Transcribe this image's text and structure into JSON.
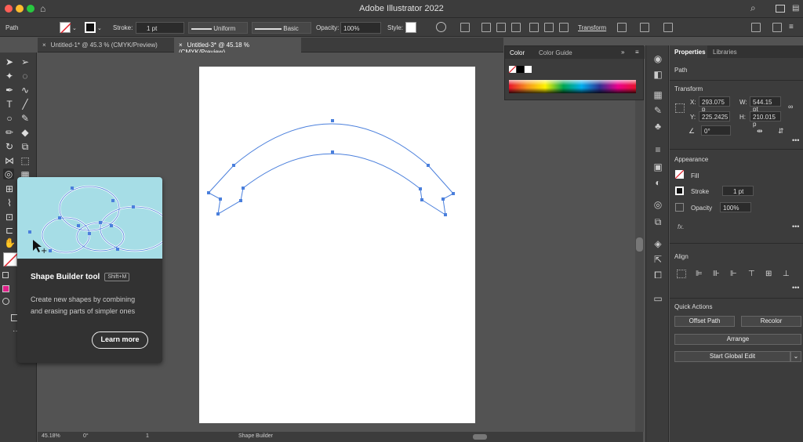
{
  "app": {
    "title": "Adobe Illustrator 2022"
  },
  "control": {
    "selection": "Path",
    "stroke_label": "Stroke:",
    "stroke_weight": "1 pt",
    "profile": "Uniform",
    "brush": "Basic",
    "opacity_label": "Opacity:",
    "opacity": "100%",
    "style_label": "Style:",
    "transform": "Transform"
  },
  "tabs": [
    {
      "label": "Untitled-1* @ 45.3 % (CMYK/Preview)"
    },
    {
      "label": "Untitled-3* @ 45.18 % (CMYK/Preview)"
    }
  ],
  "tooltip": {
    "title": "Shape Builder tool",
    "shortcut": "Shift+M",
    "description_line1": "Create new shapes by combining",
    "description_line2": "and erasing parts of simpler ones",
    "button": "Learn more"
  },
  "color_panel": {
    "tab1": "Color",
    "tab2": "Color Guide"
  },
  "properties": {
    "tab1": "Properties",
    "tab2": "Libraries",
    "object": "Path",
    "transform_title": "Transform",
    "x_label": "X:",
    "x": "293.075 p",
    "w_label": "W:",
    "w": "544.15 pt",
    "y_label": "Y:",
    "y": "225.2425",
    "h_label": "H:",
    "h": "210.015 p",
    "angle": "0°",
    "appearance_title": "Appearance",
    "fill": "Fill",
    "stroke": "Stroke",
    "stroke_weight": "1 pt",
    "opacity": "Opacity",
    "opacity_value": "100%",
    "fx": "fx.",
    "align_title": "Align",
    "quick_actions": "Quick Actions",
    "offset_path": "Offset Path",
    "recolor": "Recolor",
    "arrange": "Arrange",
    "global_edit": "Start Global Edit"
  },
  "status": {
    "zoom": "45.18%",
    "rotation": "0°",
    "artboard": "1",
    "tool": "Shape Builder"
  },
  "colors": {
    "path": "#4a7fdc",
    "accent": "#a6dde6"
  }
}
